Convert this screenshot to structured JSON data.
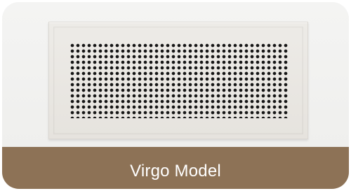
{
  "product": {
    "name": "Virgo Model",
    "image_icon": "vent-grille-photo"
  },
  "colors": {
    "band": "#8d7256",
    "text": "#ffffff",
    "vent": "#e8e5e0",
    "holes": "#161616"
  }
}
